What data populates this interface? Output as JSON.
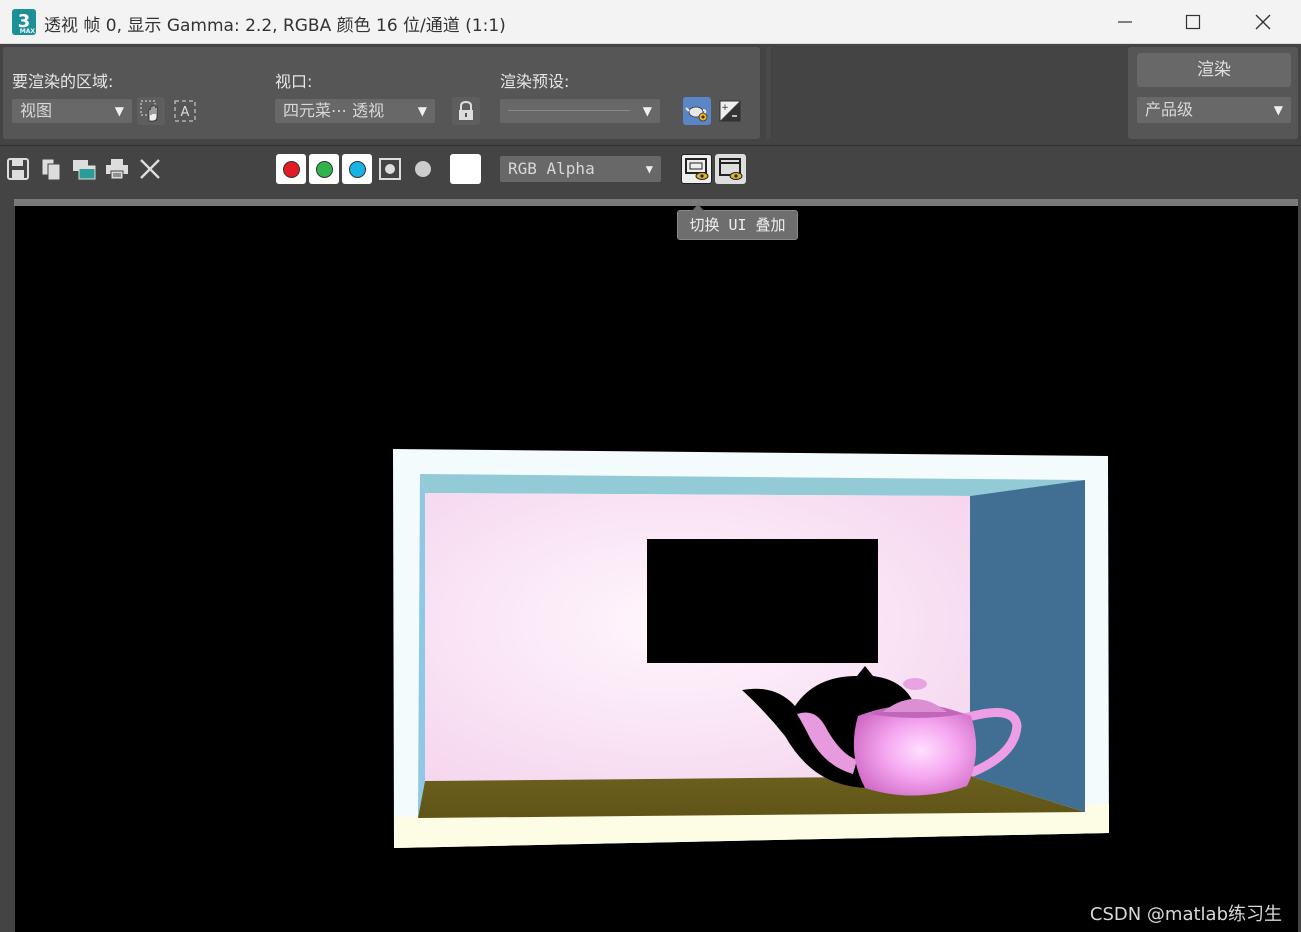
{
  "window": {
    "app_logo": "3",
    "title": "透视 帧 0, 显示 Gamma: 2.2, RGBA 颜色 16 位/通道 (1:1)",
    "min_icon": "minimize-icon",
    "max_icon": "maximize-icon",
    "close_icon": "close-icon"
  },
  "render_area": {
    "label": "要渲染的区域:",
    "value": "视图"
  },
  "viewport": {
    "label": "视口:",
    "value": "四元菜⋯ 透视"
  },
  "preset": {
    "label": "渲染预设:",
    "value": ""
  },
  "render": {
    "button_label": "渲染",
    "quality_value": "产品级"
  },
  "toolbar": {
    "channel_display": "RGB Alpha",
    "channel_colors": {
      "red": "#e01c24",
      "green": "#2fb34a",
      "blue": "#18b4e6"
    }
  },
  "tooltip": "切换 UI 叠加",
  "watermark": "CSDN @matlab练习生"
}
